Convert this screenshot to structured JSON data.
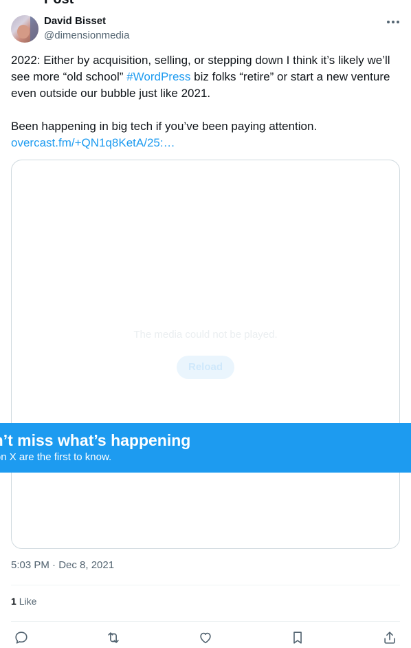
{
  "header": {
    "title_cut": "Post"
  },
  "author": {
    "name": "David Bisset",
    "handle": "@dimensionmedia",
    "avatar": "avatar-photo"
  },
  "tweet": {
    "line1_before_hashtag": "2022: Either by acquisition, selling, or stepping down I think it’s likely we’ll see more “old school” ",
    "hashtag": "#WordPress",
    "line1_after_hashtag": " biz folks “retire” or start a new venture even outside our bubble just like 2021.",
    "paragraph2": "Been happening in big tech if you’ve been paying attention.",
    "link": "overcast.fm/+QN1q8KetA/25:…"
  },
  "media": {
    "error_text": "The media could not be played.",
    "reload_label": "Reload"
  },
  "banner": {
    "title": "Don’t miss what’s happening",
    "subtitle": "People on X are the first to know."
  },
  "meta": {
    "timestamp": "5:03 PM · Dec 8, 2021",
    "likes_count": "1",
    "likes_label": "Like"
  },
  "icons": {
    "more": "more-horizontal-icon",
    "reply": "reply-icon",
    "repost": "repost-icon",
    "like": "heart-icon",
    "bookmark": "bookmark-icon",
    "share": "share-icon"
  },
  "colors": {
    "accent": "#1d9bf0",
    "text": "#0f1419",
    "secondary": "#536471",
    "border": "#cfd9de"
  }
}
